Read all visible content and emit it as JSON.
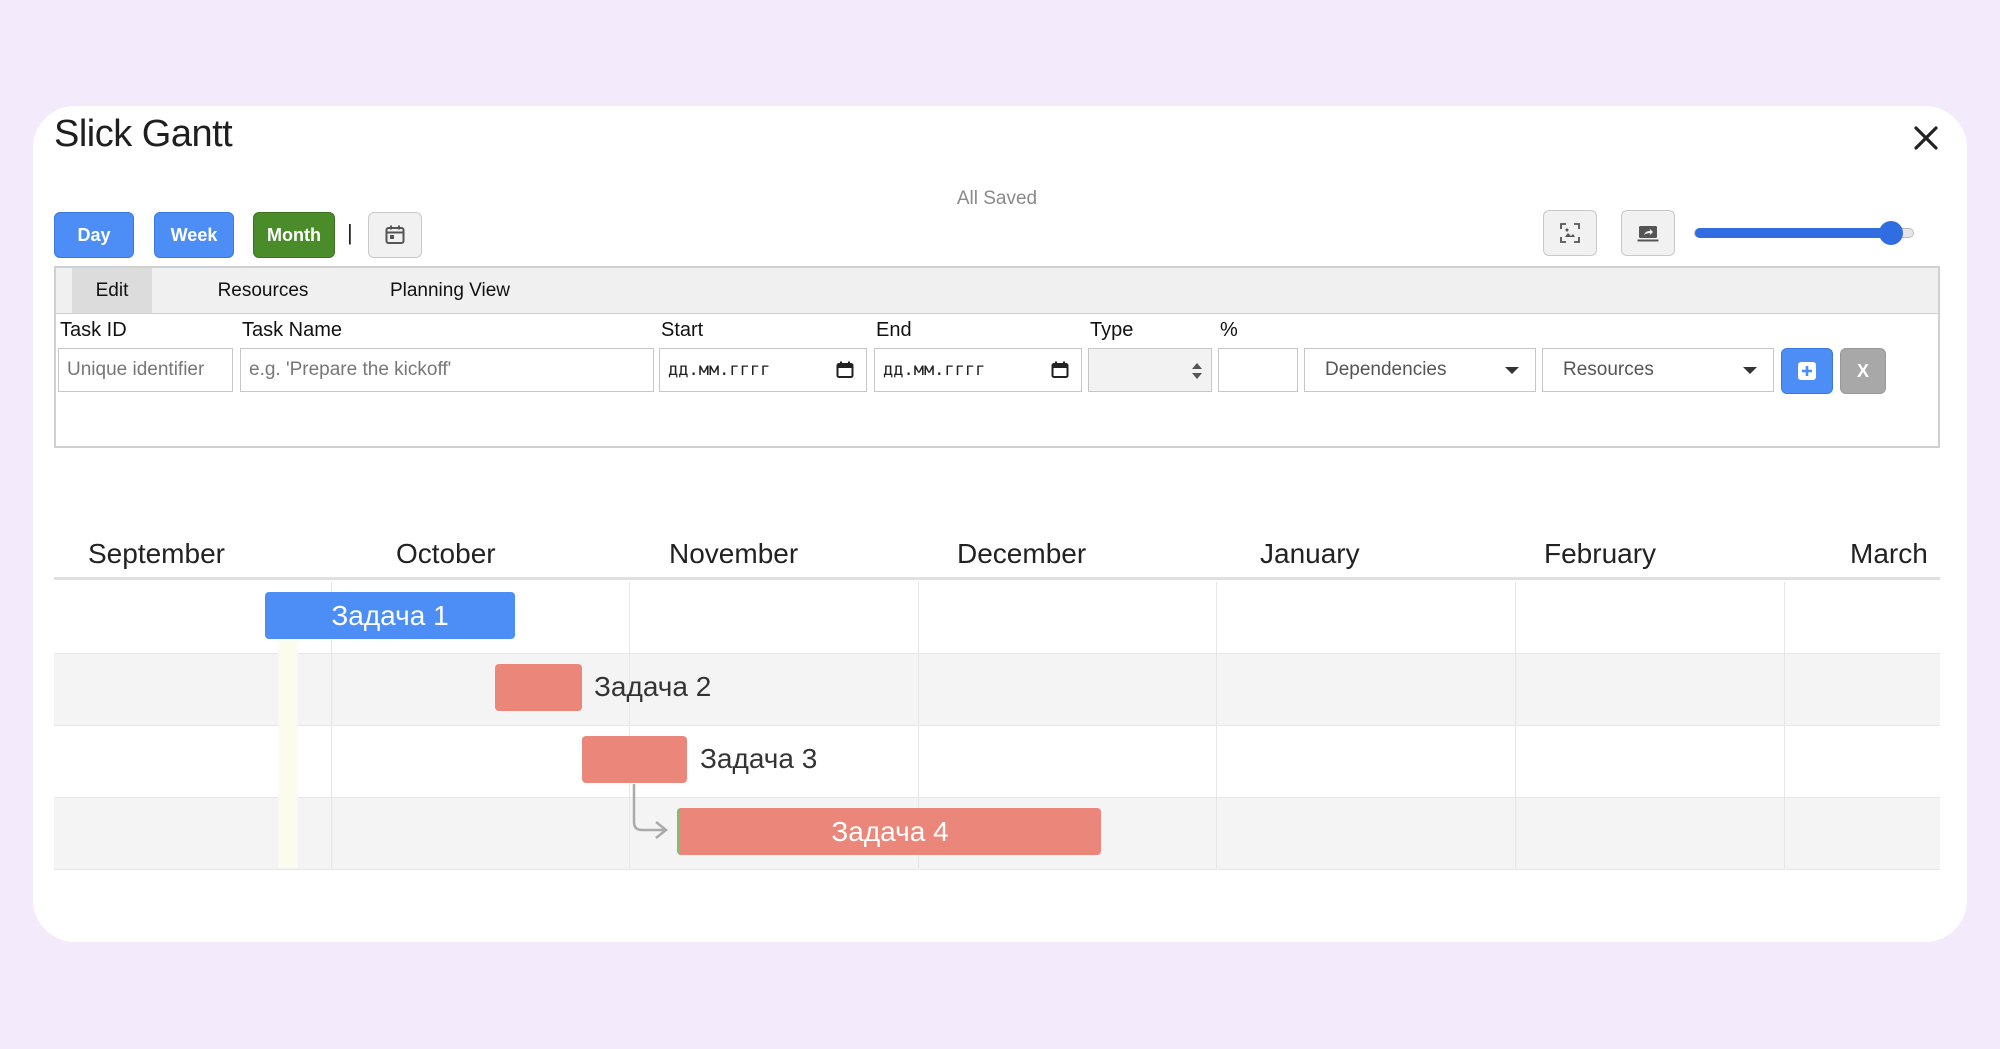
{
  "app": {
    "title": "Slick Gantt",
    "status": "All Saved"
  },
  "toolbar": {
    "day": "Day",
    "week": "Week",
    "month": "Month",
    "separator": "|",
    "zoom_level": 0.9
  },
  "tabs": [
    {
      "label": "Edit",
      "active": true
    },
    {
      "label": "Resources",
      "active": false
    },
    {
      "label": "Planning View",
      "active": false
    }
  ],
  "form": {
    "task_id_label": "Task ID",
    "task_id_placeholder": "Unique identifier",
    "task_name_label": "Task Name",
    "task_name_placeholder": "e.g. 'Prepare the kickoff'",
    "start_label": "Start",
    "start_value": "дд.мм.гггг",
    "end_label": "End",
    "end_value": "дд.мм.гггг",
    "type_label": "Type",
    "percent_label": "%",
    "dependencies_value": "Dependencies",
    "resources_value": "Resources",
    "add_symbol": "+",
    "cancel_symbol": "X"
  },
  "timeline": {
    "months": [
      "September",
      "October",
      "November",
      "December",
      "January",
      "February",
      "March"
    ]
  },
  "tasks": [
    {
      "name": "Задача 1",
      "color": "#4c8ef5",
      "label_inside": true
    },
    {
      "name": "Задача 2",
      "color": "#ea877a",
      "label_inside": false
    },
    {
      "name": "Задача 3",
      "color": "#ea877a",
      "label_inside": false
    },
    {
      "name": "Задача 4",
      "color": "#ea877a",
      "label_inside": true,
      "depends_on": "Задача 3"
    }
  ],
  "colors": {
    "primary": "#4c8ef5",
    "month_active": "#4a8c2a",
    "task_default": "#ea877a",
    "background": "#f3ebfc"
  }
}
